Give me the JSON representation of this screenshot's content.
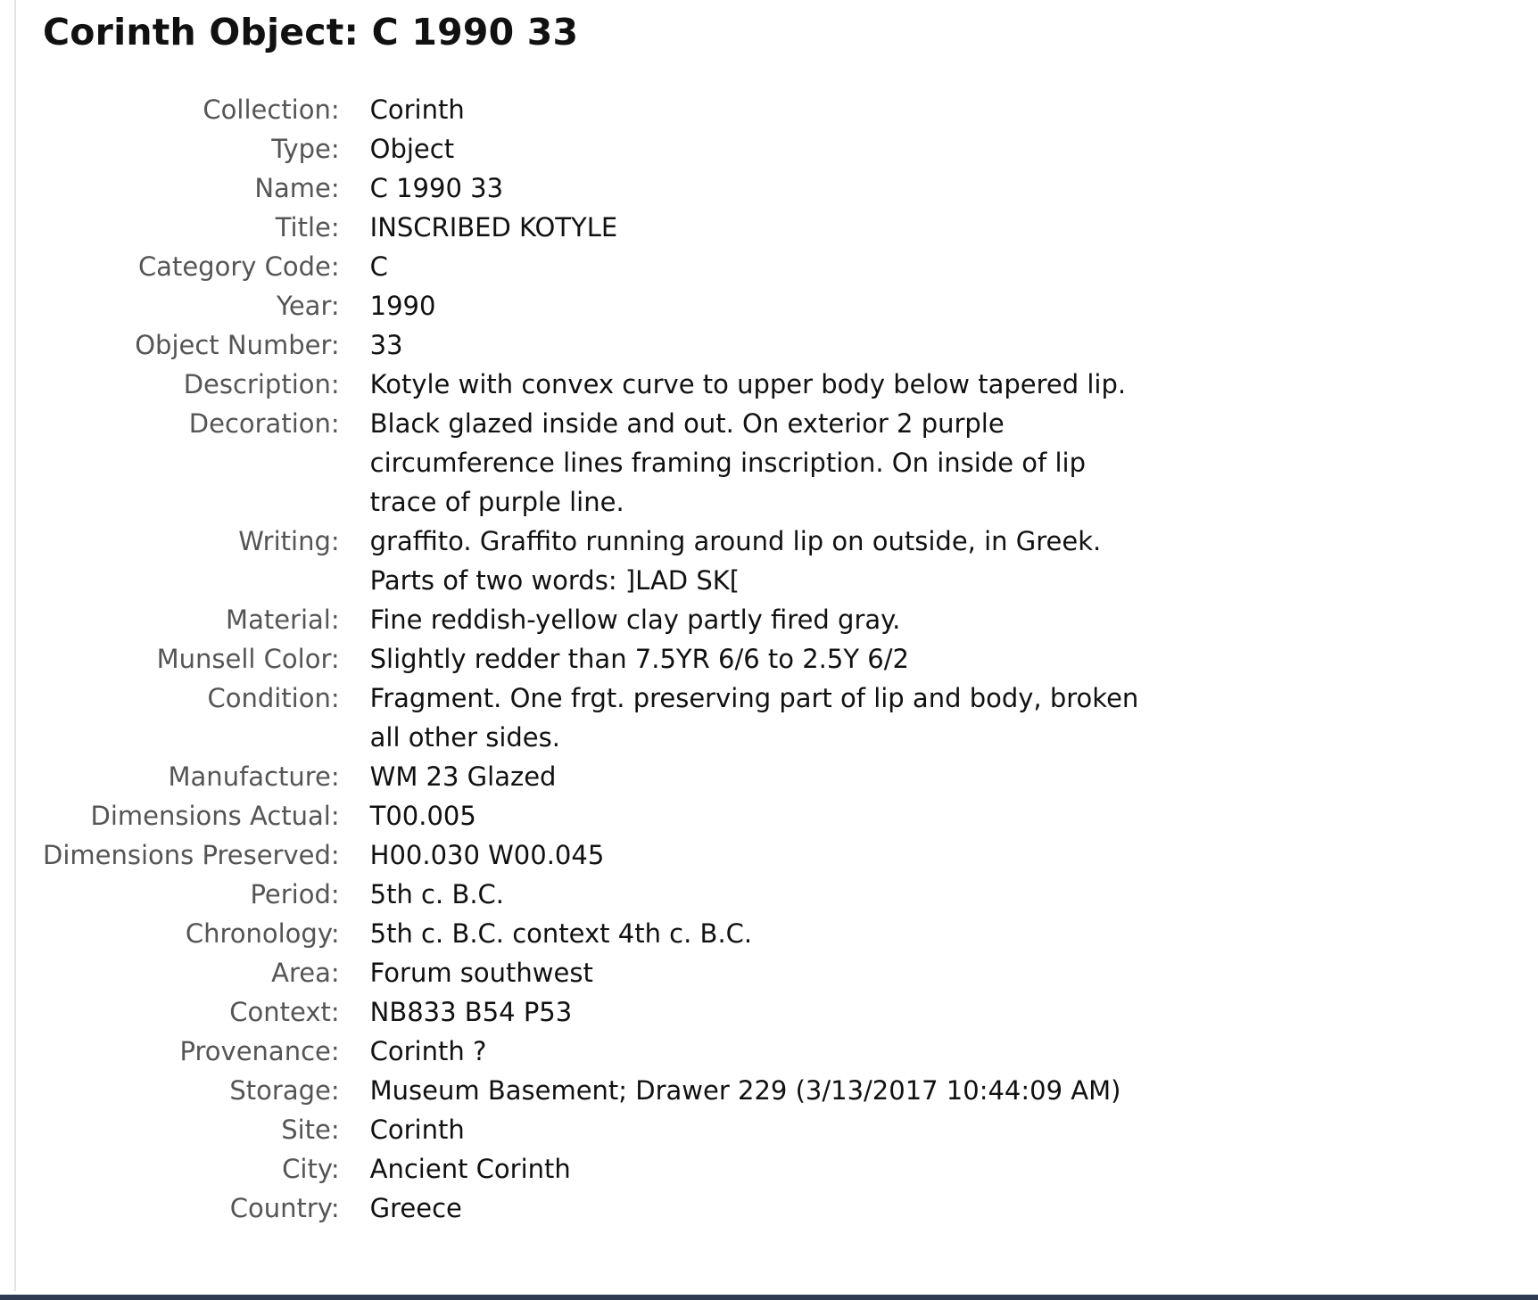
{
  "page_title": "Corinth Object: C 1990 33",
  "fields": [
    {
      "label": "Collection:",
      "value": "Corinth"
    },
    {
      "label": "Type:",
      "value": "Object"
    },
    {
      "label": "Name:",
      "value": "C 1990 33"
    },
    {
      "label": "Title:",
      "value": "INSCRIBED KOTYLE"
    },
    {
      "label": "Category Code:",
      "value": "C"
    },
    {
      "label": "Year:",
      "value": "1990"
    },
    {
      "label": "Object Number:",
      "value": "33"
    },
    {
      "label": "Description:",
      "value": "Kotyle with convex curve to upper body below tapered lip."
    },
    {
      "label": "Decoration:",
      "value": "Black glazed inside and out. On exterior 2 purple circumference lines framing inscription. On inside of lip trace of purple line."
    },
    {
      "label": "Writing:",
      "value": "graffito. Graffito running around lip on outside, in Greek. Parts of two words: ]LAD SK["
    },
    {
      "label": "Material:",
      "value": "Fine reddish-yellow clay partly fired gray."
    },
    {
      "label": "Munsell Color:",
      "value": "Slightly redder than 7.5YR 6/6 to 2.5Y 6/2"
    },
    {
      "label": "Condition:",
      "value": "Fragment. One frgt. preserving part of lip and body, broken all other sides."
    },
    {
      "label": "Manufacture:",
      "value": "WM 23 Glazed"
    },
    {
      "label": "Dimensions Actual:",
      "value": "T00.005"
    },
    {
      "label": "Dimensions Preserved:",
      "value": "H00.030 W00.045"
    },
    {
      "label": "Period:",
      "value": "5th c. B.C."
    },
    {
      "label": "Chronology:",
      "value": "5th c. B.C. context 4th c. B.C."
    },
    {
      "label": "Area:",
      "value": "Forum southwest"
    },
    {
      "label": "Context:",
      "value": "NB833 B54 P53"
    },
    {
      "label": "Provenance:",
      "value": "Corinth ?"
    },
    {
      "label": "Storage:",
      "value": "Museum Basement; Drawer 229 (3/13/2017 10:44:09 AM)"
    },
    {
      "label": "Site:",
      "value": "Corinth"
    },
    {
      "label": "City:",
      "value": "Ancient Corinth"
    },
    {
      "label": "Country:",
      "value": "Greece"
    }
  ]
}
